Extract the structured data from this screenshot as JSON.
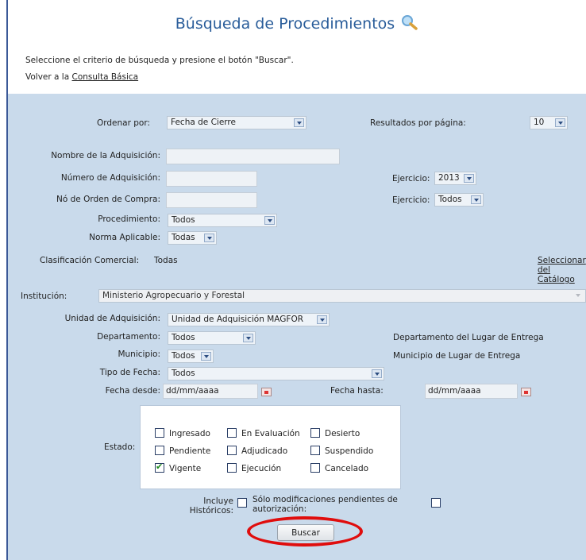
{
  "header": {
    "title": "Búsqueda de Procedimientos",
    "instructions": "Seleccione el criterio de búsqueda y presione el botón \"Buscar\".",
    "back_prefix": "Volver a la",
    "back_link": "Consulta Básica"
  },
  "form": {
    "order_label": "Ordenar por:",
    "order_value": "Fecha de Cierre",
    "results_label": "Resultados por página:",
    "results_value": "10",
    "name_label": "Nombre de la Adquisición:",
    "name_value": "",
    "number_label": "Número de Adquisición:",
    "number_value": "",
    "ejercicio1_label": "Ejercicio:",
    "ejercicio1_value": "2013",
    "order_num_label": "Nó de Orden de Compra:",
    "order_num_value": "",
    "ejercicio2_label": "Ejercicio:",
    "ejercicio2_value": "Todos",
    "procedimiento_label": "Procedimiento:",
    "procedimiento_value": "Todos",
    "norma_label": "Norma Aplicable:",
    "norma_value": "Todas",
    "clasificacion_label": "Clasificación Comercial:",
    "clasificacion_value": "Todas",
    "catalog_link_l1": "Seleccionar",
    "catalog_link_l2": "del",
    "catalog_link_l3": "Catálogo",
    "institucion_label": "Institución:",
    "institucion_value": "Ministerio Agropecuario y Forestal",
    "unidad_label": "Unidad de Adquisición:",
    "unidad_value": "Unidad de Adquisición MAGFOR",
    "departamento_label": "Departamento:",
    "departamento_value": "Todos",
    "departamento_note": "Departamento del Lugar de Entrega",
    "municipio_label": "Municipio:",
    "municipio_value": "Todos",
    "municipio_note": "Municipio de Lugar de Entrega",
    "tipo_fecha_label": "Tipo de Fecha:",
    "tipo_fecha_value": "Todos",
    "fecha_desde_label": "Fecha desde:",
    "fecha_desde_placeholder": "dd/mm/aaaa",
    "fecha_hasta_label": "Fecha hasta:",
    "fecha_hasta_placeholder": "dd/mm/aaaa",
    "estado_label": "Estado:",
    "estado_options": [
      {
        "label": "Ingresado",
        "checked": false
      },
      {
        "label": "En Evaluación",
        "checked": false
      },
      {
        "label": "Desierto",
        "checked": false
      },
      {
        "label": "Pendiente",
        "checked": false
      },
      {
        "label": "Adjudicado",
        "checked": false
      },
      {
        "label": "Suspendido",
        "checked": false
      },
      {
        "label": "Vigente",
        "checked": true
      },
      {
        "label": "Ejecución",
        "checked": false
      },
      {
        "label": "Cancelado",
        "checked": false
      }
    ],
    "historicos_l1": "Incluye",
    "historicos_l2": "Históricos:",
    "mods_l1": "Sólo modificaciones pendientes de",
    "mods_l2": "autorización:",
    "submit_label": "Buscar"
  },
  "colors": {
    "title": "#2a5d9a",
    "panel_bg": "#c9daeb",
    "highlight_ring": "#e00d0d",
    "check": "#1e8a1e"
  }
}
